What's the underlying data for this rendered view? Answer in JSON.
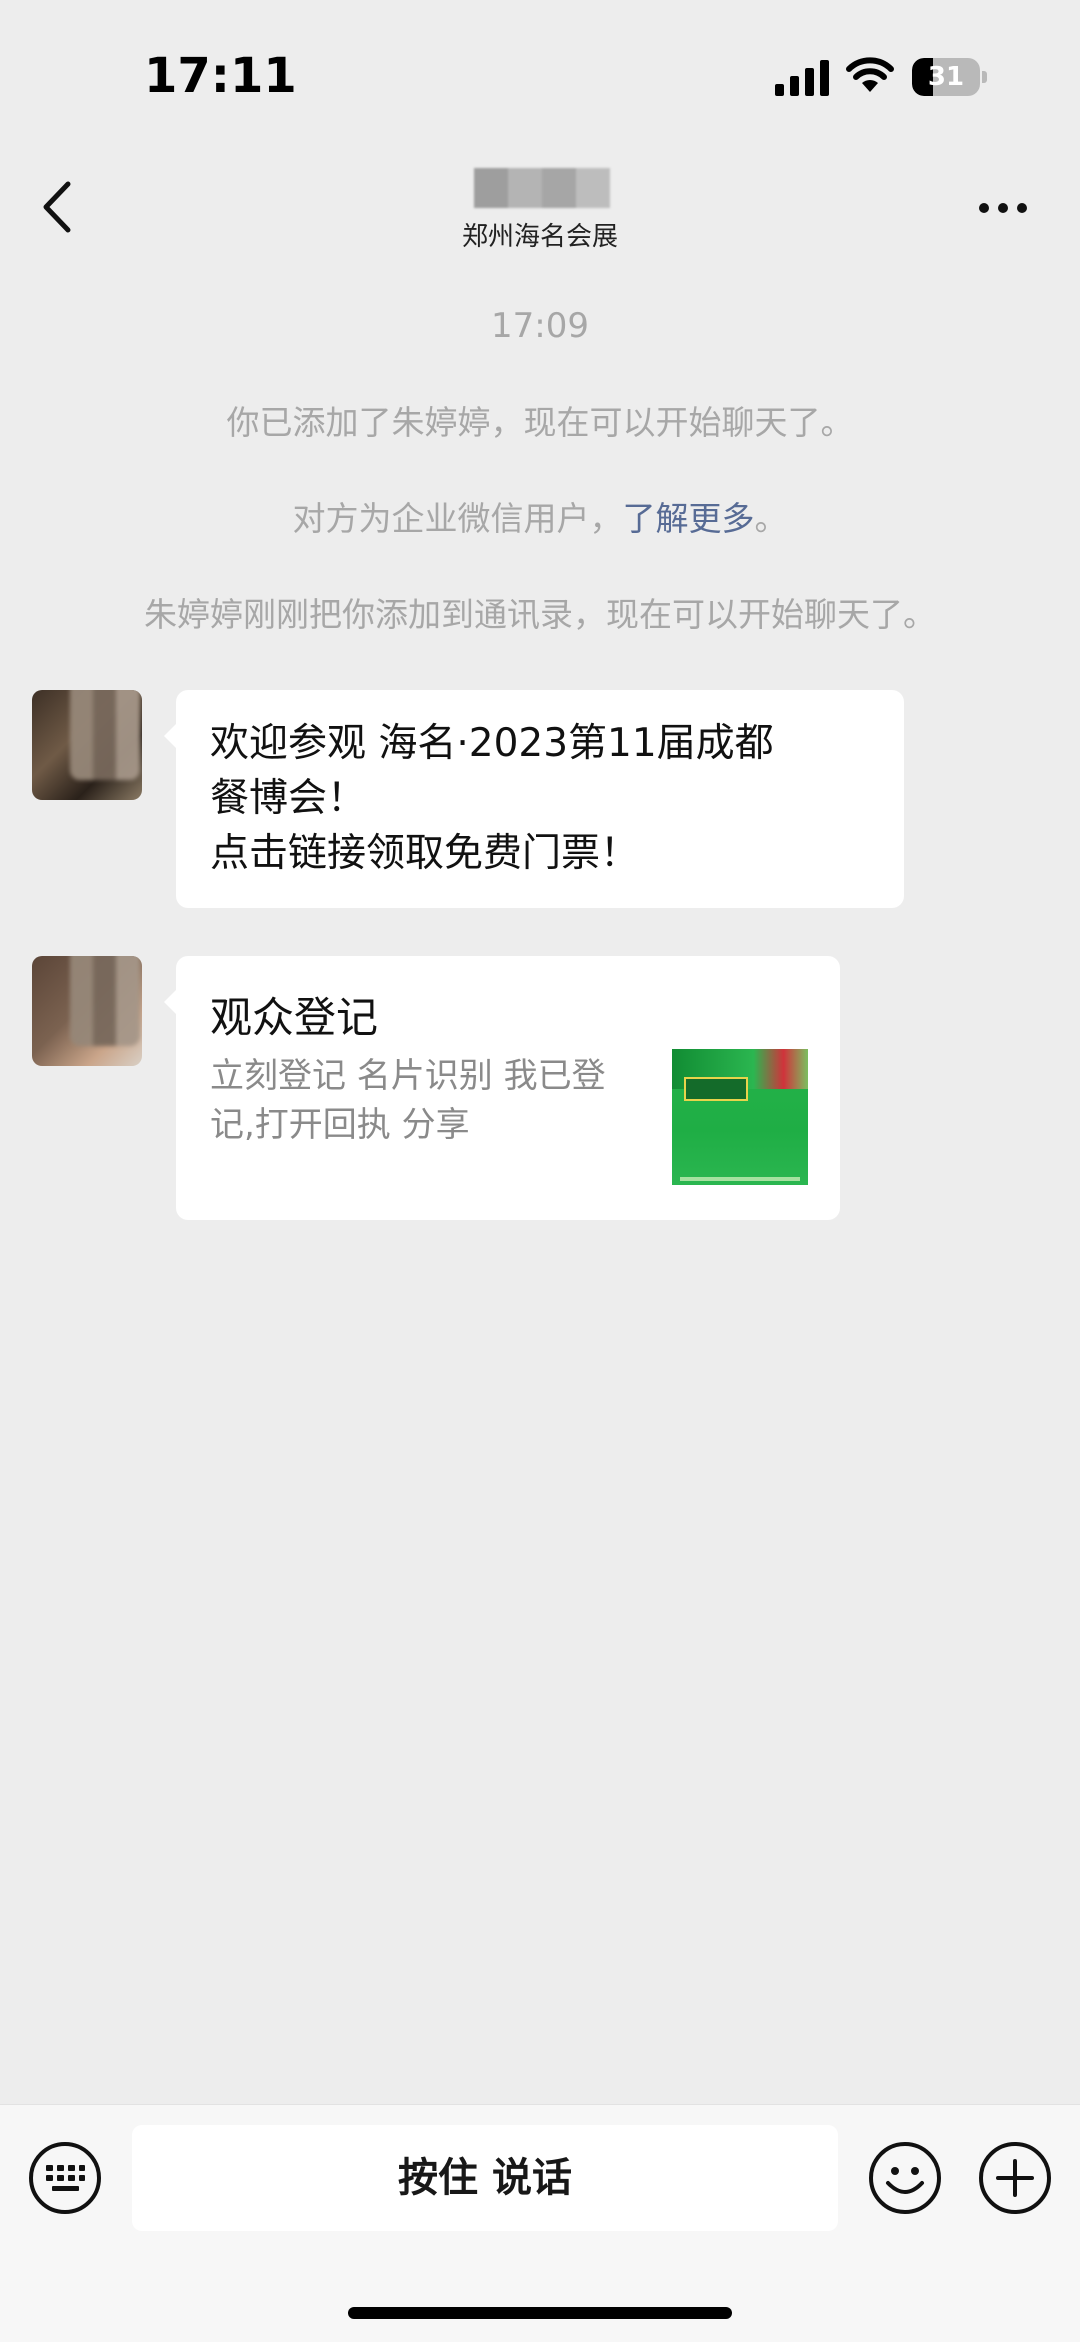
{
  "status_bar": {
    "time": "17:11",
    "battery_level": "31",
    "battery_fraction": 0.31
  },
  "nav": {
    "subtitle": "郑州海名会展"
  },
  "chat": {
    "timestamp": "17:09",
    "system_messages": {
      "added": "你已添加了朱婷婷，现在可以开始聊天了。",
      "enterprise_prefix": "对方为企业微信用户，",
      "enterprise_link": "了解更多",
      "enterprise_suffix": "。",
      "contact_added": "朱婷婷刚刚把你添加到通讯录，现在可以开始聊天了。"
    },
    "messages": [
      {
        "text": "欢迎参观  海名·2023第11届成都\n餐博会！\n点击链接领取免费门票！"
      },
      {
        "card_title": "观众登记",
        "card_desc": "立刻登记 名片识别 我已登记,打开回执 分享"
      }
    ]
  },
  "input_bar": {
    "talk_label": "按住 说话"
  },
  "colors": {
    "background": "#ededed",
    "bubble": "#ffffff",
    "link": "#576b95",
    "system_text": "#a7a7a7"
  },
  "icons": [
    "back-icon",
    "more-icon",
    "keyboard-icon",
    "emoji-icon",
    "plus-icon",
    "signal-icon",
    "wifi-icon",
    "battery-icon"
  ]
}
